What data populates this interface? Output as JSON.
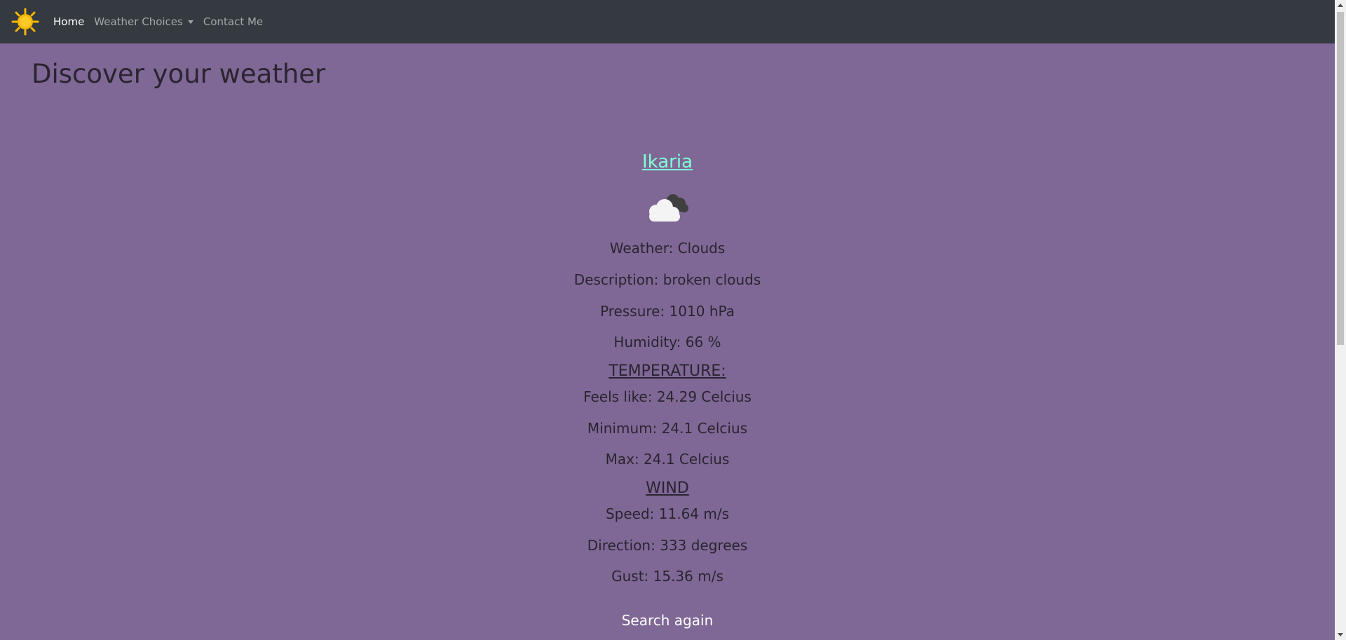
{
  "navbar": {
    "brand_icon": "sun-icon",
    "links": {
      "home": "Home",
      "weather_choices": "Weather Choices",
      "contact": "Contact Me"
    }
  },
  "page": {
    "title": "Discover your weather"
  },
  "weather": {
    "city": "Ikaria",
    "icon": "broken-clouds-icon",
    "weather": "Weather: Clouds",
    "description": "Description: broken clouds",
    "pressure": "Pressure: 1010 hPa",
    "humidity": "Humidity: 66 %",
    "temperature_heading": "TEMPERATURE:",
    "feels_like": "Feels like: 24.29 Celcius",
    "minimum": "Minimum: 24.1 Celcius",
    "max": "Max: 24.1 Celcius",
    "wind_heading": "WIND",
    "speed": "Speed: 11.64 m/s",
    "direction": "Direction: 333 degrees",
    "gust": "Gust: 15.36 m/s"
  },
  "actions": {
    "search_again": "Search again"
  },
  "colors": {
    "background": "#7f6896",
    "navbar": "#343a40",
    "city_link": "#7fffd4",
    "sun": "#f5b800"
  }
}
